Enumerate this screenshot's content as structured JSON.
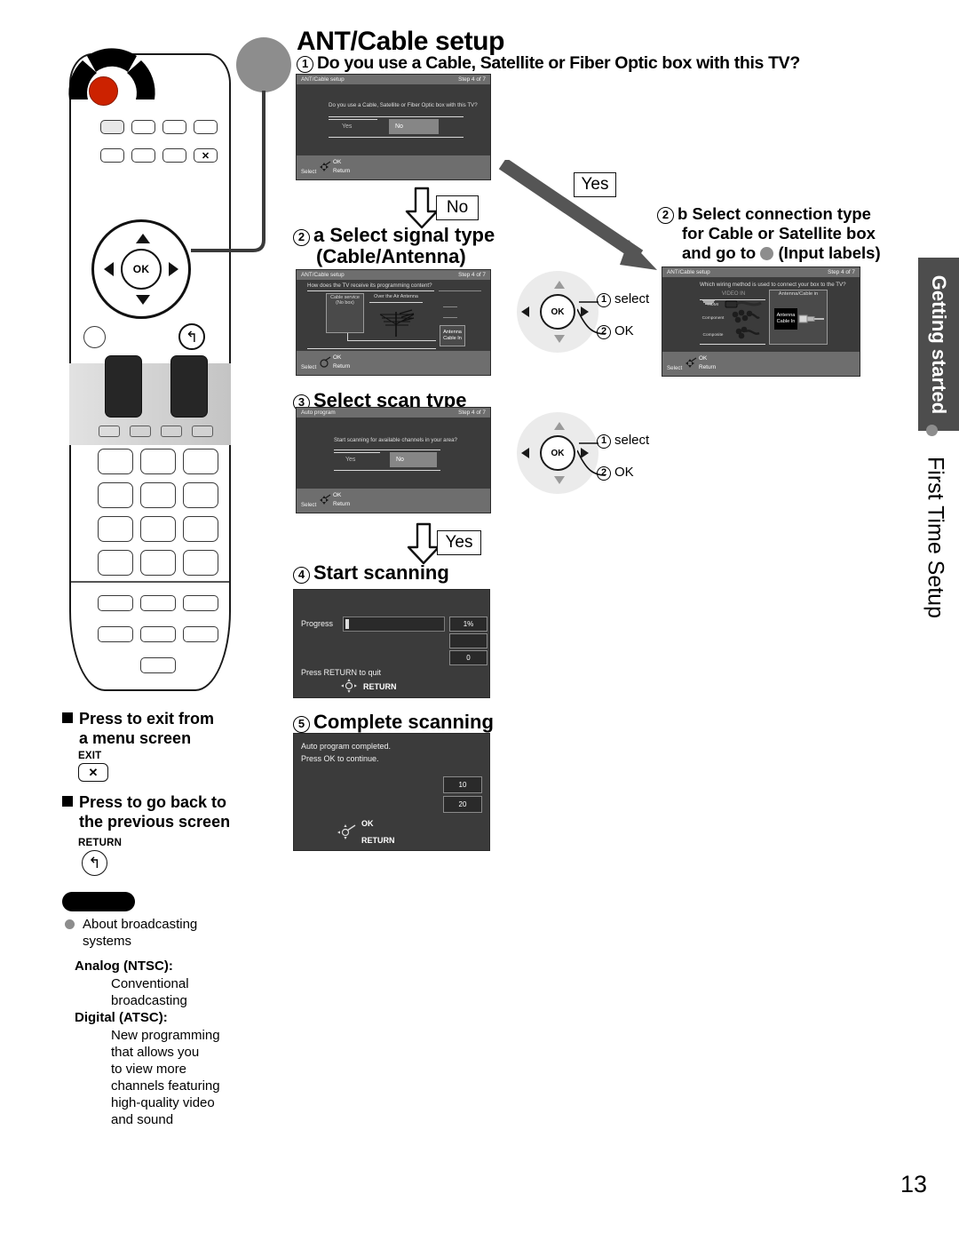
{
  "page": {
    "title": "ANT/Cable setup",
    "number": "13",
    "side_tab": "Getting started",
    "side_label": "First Time Setup"
  },
  "steps": {
    "q1": "Do you use a Cable, Satellite or Fiber Optic box with this TV?",
    "s2a_line1": "Select signal type",
    "s2a_line2": "(Cable/Antenna)",
    "s2b_line1": "Select connection type",
    "s2b_line2": "for Cable or Satellite box",
    "s2b_line3_a": "and go to",
    "s2b_line3_b": "(Input labels)",
    "s3": "Select scan type",
    "s4": "Start scanning",
    "s5": "Complete scanning",
    "num1": "1",
    "num2a": "2",
    "num2a_suffix": "a",
    "num2b": "2",
    "num2b_suffix": "b",
    "num3": "3",
    "num4": "4",
    "num5": "5"
  },
  "flow": {
    "no_label": "No",
    "yes_label_top": "Yes",
    "yes_label_mid": "Yes"
  },
  "dpad_diagrams": [
    {
      "ok": "OK",
      "select_num": "1",
      "select_label": "select",
      "ok_num": "2",
      "ok_label": "OK"
    },
    {
      "ok": "OK",
      "select_num": "1",
      "select_label": "select",
      "ok_num": "2",
      "ok_label": "OK"
    }
  ],
  "tv_screens": {
    "screen1": {
      "title": "ANT/Cable setup",
      "step": "Step 4 of 7",
      "question": "Do you use a Cable, Satellite or Fiber Optic box with this TV?",
      "options": [
        "Yes",
        "No"
      ],
      "selected": "No",
      "footer": {
        "select": "Select",
        "ok": "OK",
        "return": "Return"
      }
    },
    "screen2a": {
      "title": "ANT/Cable setup",
      "step": "Step 4 of 7",
      "question": "How does the TV receive its programming content?",
      "option_left_line1": "Cable service",
      "option_left_line2": "(No box)",
      "option_right": "Over the Air Antenna",
      "jack_line1": "Antenna",
      "jack_line2": "Cable In",
      "footer": {
        "select": "Select",
        "ok": "OK",
        "return": "Return"
      }
    },
    "screen2b": {
      "title": "ANT/Cable setup",
      "step": "Step 4 of 7",
      "question": "Which wiring method is used to connect your box to the TV?",
      "group_left": "VIDEO IN",
      "group_right": "Antenna/Cable in",
      "inputs": [
        "HDMI",
        "Component",
        "Composite"
      ],
      "jack_line1": "Antenna",
      "jack_line2": "Cable In",
      "footer": {
        "select": "Select",
        "ok": "OK",
        "return": "Return"
      }
    },
    "screen3": {
      "title": "Auto program",
      "step": "Step 4 of 7",
      "question": "Start scanning for available channels in your area?",
      "options": [
        "Yes",
        "No"
      ],
      "selected": "No",
      "footer": {
        "select": "Select",
        "ok": "OK",
        "return": "Return"
      }
    },
    "screen4": {
      "progress_label": "Progress",
      "progress_value": "1%",
      "progress_percent": 1,
      "blank_value": "",
      "count_value": "0",
      "quit_text": "Press RETURN to quit",
      "return_label": "RETURN"
    },
    "screen5": {
      "line1": "Auto program completed.",
      "line2": "Press OK to continue.",
      "value1": "10",
      "value2": "20",
      "ok_label": "OK",
      "return_label": "RETURN"
    }
  },
  "instructions": {
    "exit_line1": "Press to exit from",
    "exit_line2": "a menu screen",
    "exit_key_label": "EXIT",
    "exit_key_glyph": "✕",
    "return_line1": "Press to go back to",
    "return_line2": "the previous screen",
    "return_key_label": "RETURN",
    "return_key_glyph": "↰"
  },
  "note": {
    "heading_line1": "About broadcasting",
    "heading_line2": "systems",
    "analog_term": "Analog (NTSC):",
    "analog_desc_lines": [
      "Conventional",
      "broadcasting"
    ],
    "digital_term": "Digital (ATSC):",
    "digital_desc_lines": [
      "New programming",
      "that allows you",
      "to view more",
      "channels featuring",
      "high-quality video",
      "and sound"
    ]
  },
  "remote": {
    "ok_label": "OK",
    "return_glyph": "↰",
    "exit_glyph": "✕"
  },
  "colors": {
    "accent_grey": "#8d8d8d",
    "tab_grey": "#4d4d4d",
    "power_red": "#cc2200",
    "screen_bg": "#3b3b3b"
  }
}
